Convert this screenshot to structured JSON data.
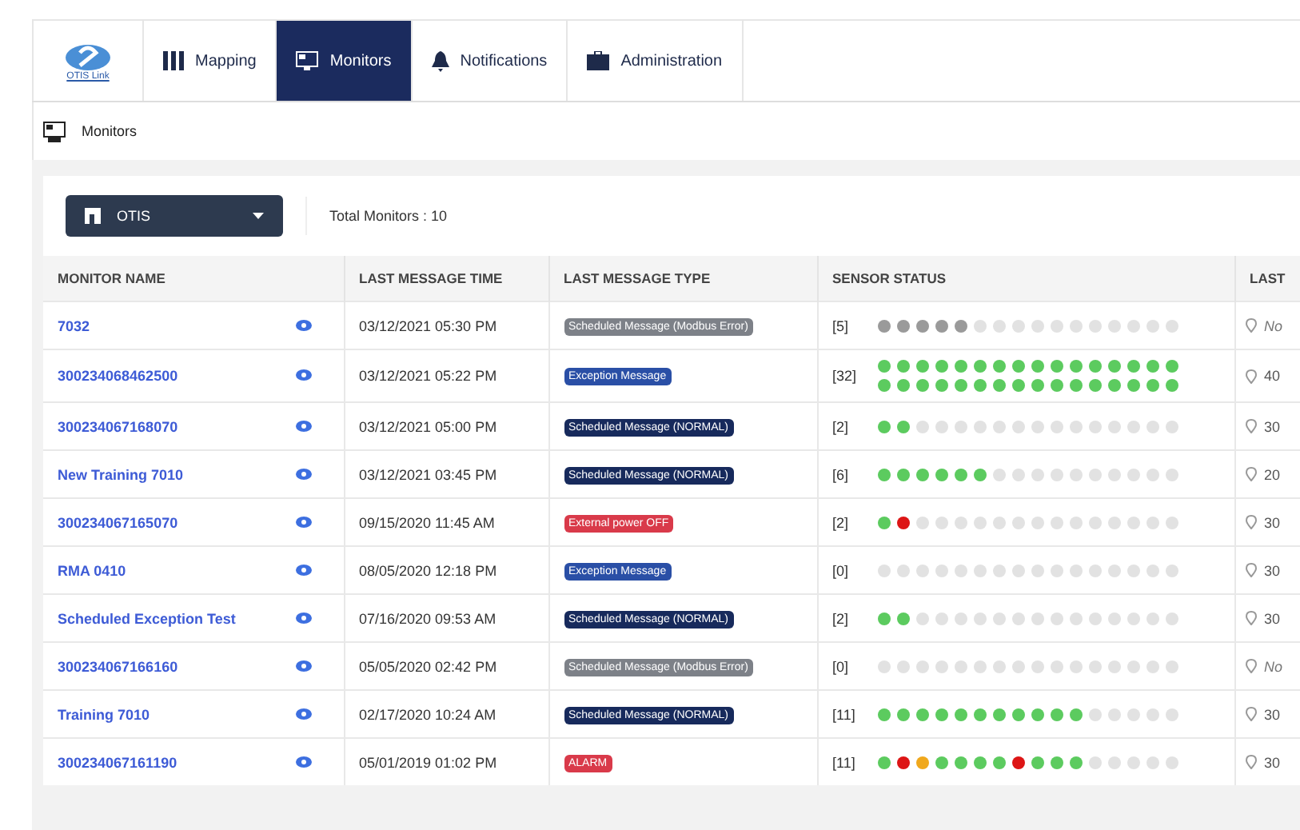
{
  "logo": {
    "text": "OTIS Link"
  },
  "nav": [
    {
      "label": "Mapping",
      "selected": false
    },
    {
      "label": "Monitors",
      "selected": true
    },
    {
      "label": "Notifications",
      "selected": false
    },
    {
      "label": "Administration",
      "selected": false
    }
  ],
  "breadcrumb": "Monitors",
  "org_select": {
    "value": "OTIS"
  },
  "total": "Total Monitors : 10",
  "table": {
    "columns": [
      "MONITOR NAME",
      "LAST MESSAGE TIME",
      "LAST MESSAGE TYPE",
      "SENSOR STATUS",
      "LAST"
    ],
    "rows": [
      {
        "name": "7032",
        "time": "03/12/2021 05:30 PM",
        "type": {
          "text": "Scheduled Message (Modbus Error)",
          "kind": "modbus"
        },
        "count": "[5]",
        "dots": [
          {
            "color": "#9a9a9a"
          },
          {
            "color": "#9a9a9a"
          },
          {
            "color": "#9a9a9a"
          },
          {
            "color": "#9a9a9a"
          },
          {
            "color": "#9a9a9a"
          },
          {
            "color": "#e2e2e2"
          },
          {
            "color": "#e2e2e2"
          },
          {
            "color": "#e2e2e2"
          },
          {
            "color": "#e2e2e2"
          },
          {
            "color": "#e2e2e2"
          },
          {
            "color": "#e2e2e2"
          },
          {
            "color": "#e2e2e2"
          },
          {
            "color": "#e2e2e2"
          },
          {
            "color": "#e2e2e2"
          },
          {
            "color": "#e2e2e2"
          },
          {
            "color": "#e2e2e2"
          }
        ],
        "last": "No",
        "last_italic": true
      },
      {
        "name": "300234068462500",
        "time": "03/12/2021 05:22 PM",
        "type": {
          "text": "Exception Message",
          "kind": "exception"
        },
        "count": "[32]",
        "dots": [
          {
            "color": "#5ccb5f"
          },
          {
            "color": "#5ccb5f"
          },
          {
            "color": "#5ccb5f"
          },
          {
            "color": "#5ccb5f"
          },
          {
            "color": "#5ccb5f"
          },
          {
            "color": "#5ccb5f"
          },
          {
            "color": "#5ccb5f"
          },
          {
            "color": "#5ccb5f"
          },
          {
            "color": "#5ccb5f"
          },
          {
            "color": "#5ccb5f"
          },
          {
            "color": "#5ccb5f"
          },
          {
            "color": "#5ccb5f"
          },
          {
            "color": "#5ccb5f"
          },
          {
            "color": "#5ccb5f"
          },
          {
            "color": "#5ccb5f"
          },
          {
            "color": "#5ccb5f"
          },
          {
            "color": "#5ccb5f"
          },
          {
            "color": "#5ccb5f"
          },
          {
            "color": "#5ccb5f"
          },
          {
            "color": "#5ccb5f"
          },
          {
            "color": "#5ccb5f"
          },
          {
            "color": "#5ccb5f"
          },
          {
            "color": "#5ccb5f"
          },
          {
            "color": "#5ccb5f"
          },
          {
            "color": "#5ccb5f"
          },
          {
            "color": "#5ccb5f"
          },
          {
            "color": "#5ccb5f"
          },
          {
            "color": "#5ccb5f"
          },
          {
            "color": "#5ccb5f"
          },
          {
            "color": "#5ccb5f"
          },
          {
            "color": "#5ccb5f"
          },
          {
            "color": "#5ccb5f"
          }
        ],
        "last": "40",
        "last_italic": false
      },
      {
        "name": "300234067168070",
        "time": "03/12/2021 05:00 PM",
        "type": {
          "text": "Scheduled Message (NORMAL)",
          "kind": "normal"
        },
        "count": "[2]",
        "dots": [
          {
            "color": "#5ccb5f"
          },
          {
            "color": "#5ccb5f"
          },
          {
            "color": "#e2e2e2"
          },
          {
            "color": "#e2e2e2"
          },
          {
            "color": "#e2e2e2"
          },
          {
            "color": "#e2e2e2"
          },
          {
            "color": "#e2e2e2"
          },
          {
            "color": "#e2e2e2"
          },
          {
            "color": "#e2e2e2"
          },
          {
            "color": "#e2e2e2"
          },
          {
            "color": "#e2e2e2"
          },
          {
            "color": "#e2e2e2"
          },
          {
            "color": "#e2e2e2"
          },
          {
            "color": "#e2e2e2"
          },
          {
            "color": "#e2e2e2"
          },
          {
            "color": "#e2e2e2"
          }
        ],
        "last": "30",
        "last_italic": false
      },
      {
        "name": "New Training 7010",
        "time": "03/12/2021 03:45 PM",
        "type": {
          "text": "Scheduled Message (NORMAL)",
          "kind": "normal"
        },
        "count": "[6]",
        "dots": [
          {
            "color": "#5ccb5f"
          },
          {
            "color": "#5ccb5f"
          },
          {
            "color": "#5ccb5f"
          },
          {
            "color": "#5ccb5f"
          },
          {
            "color": "#5ccb5f"
          },
          {
            "color": "#5ccb5f"
          },
          {
            "color": "#e2e2e2"
          },
          {
            "color": "#e2e2e2"
          },
          {
            "color": "#e2e2e2"
          },
          {
            "color": "#e2e2e2"
          },
          {
            "color": "#e2e2e2"
          },
          {
            "color": "#e2e2e2"
          },
          {
            "color": "#e2e2e2"
          },
          {
            "color": "#e2e2e2"
          },
          {
            "color": "#e2e2e2"
          },
          {
            "color": "#e2e2e2"
          }
        ],
        "last": "20",
        "last_italic": false
      },
      {
        "name": "300234067165070",
        "time": "09/15/2020 11:45 AM",
        "type": {
          "text": "External power OFF",
          "kind": "alert"
        },
        "count": "[2]",
        "dots": [
          {
            "color": "#5ccb5f"
          },
          {
            "color": "#dd1515"
          },
          {
            "color": "#e2e2e2"
          },
          {
            "color": "#e2e2e2"
          },
          {
            "color": "#e2e2e2"
          },
          {
            "color": "#e2e2e2"
          },
          {
            "color": "#e2e2e2"
          },
          {
            "color": "#e2e2e2"
          },
          {
            "color": "#e2e2e2"
          },
          {
            "color": "#e2e2e2"
          },
          {
            "color": "#e2e2e2"
          },
          {
            "color": "#e2e2e2"
          },
          {
            "color": "#e2e2e2"
          },
          {
            "color": "#e2e2e2"
          },
          {
            "color": "#e2e2e2"
          },
          {
            "color": "#e2e2e2"
          }
        ],
        "last": "30",
        "last_italic": false
      },
      {
        "name": "RMA 0410",
        "time": "08/05/2020 12:18 PM",
        "type": {
          "text": "Exception Message",
          "kind": "exception"
        },
        "count": "[0]",
        "dots": [
          {
            "color": "#e2e2e2"
          },
          {
            "color": "#e2e2e2"
          },
          {
            "color": "#e2e2e2"
          },
          {
            "color": "#e2e2e2"
          },
          {
            "color": "#e2e2e2"
          },
          {
            "color": "#e2e2e2"
          },
          {
            "color": "#e2e2e2"
          },
          {
            "color": "#e2e2e2"
          },
          {
            "color": "#e2e2e2"
          },
          {
            "color": "#e2e2e2"
          },
          {
            "color": "#e2e2e2"
          },
          {
            "color": "#e2e2e2"
          },
          {
            "color": "#e2e2e2"
          },
          {
            "color": "#e2e2e2"
          },
          {
            "color": "#e2e2e2"
          },
          {
            "color": "#e2e2e2"
          }
        ],
        "last": "30",
        "last_italic": false
      },
      {
        "name": "Scheduled Exception Test",
        "time": "07/16/2020 09:53 AM",
        "type": {
          "text": "Scheduled Message (NORMAL)",
          "kind": "normal"
        },
        "count": "[2]",
        "dots": [
          {
            "color": "#5ccb5f"
          },
          {
            "color": "#5ccb5f"
          },
          {
            "color": "#e2e2e2"
          },
          {
            "color": "#e2e2e2"
          },
          {
            "color": "#e2e2e2"
          },
          {
            "color": "#e2e2e2"
          },
          {
            "color": "#e2e2e2"
          },
          {
            "color": "#e2e2e2"
          },
          {
            "color": "#e2e2e2"
          },
          {
            "color": "#e2e2e2"
          },
          {
            "color": "#e2e2e2"
          },
          {
            "color": "#e2e2e2"
          },
          {
            "color": "#e2e2e2"
          },
          {
            "color": "#e2e2e2"
          },
          {
            "color": "#e2e2e2"
          },
          {
            "color": "#e2e2e2"
          }
        ],
        "last": "30",
        "last_italic": false
      },
      {
        "name": "300234067166160",
        "time": "05/05/2020 02:42 PM",
        "type": {
          "text": "Scheduled Message (Modbus Error)",
          "kind": "modbus"
        },
        "count": "[0]",
        "dots": [
          {
            "color": "#e2e2e2"
          },
          {
            "color": "#e2e2e2"
          },
          {
            "color": "#e2e2e2"
          },
          {
            "color": "#e2e2e2"
          },
          {
            "color": "#e2e2e2"
          },
          {
            "color": "#e2e2e2"
          },
          {
            "color": "#e2e2e2"
          },
          {
            "color": "#e2e2e2"
          },
          {
            "color": "#e2e2e2"
          },
          {
            "color": "#e2e2e2"
          },
          {
            "color": "#e2e2e2"
          },
          {
            "color": "#e2e2e2"
          },
          {
            "color": "#e2e2e2"
          },
          {
            "color": "#e2e2e2"
          },
          {
            "color": "#e2e2e2"
          },
          {
            "color": "#e2e2e2"
          }
        ],
        "last": "No",
        "last_italic": true
      },
      {
        "name": "Training 7010",
        "time": "02/17/2020 10:24 AM",
        "type": {
          "text": "Scheduled Message (NORMAL)",
          "kind": "normal"
        },
        "count": "[11]",
        "dots": [
          {
            "color": "#5ccb5f"
          },
          {
            "color": "#5ccb5f"
          },
          {
            "color": "#5ccb5f"
          },
          {
            "color": "#5ccb5f"
          },
          {
            "color": "#5ccb5f"
          },
          {
            "color": "#5ccb5f"
          },
          {
            "color": "#5ccb5f"
          },
          {
            "color": "#5ccb5f"
          },
          {
            "color": "#5ccb5f"
          },
          {
            "color": "#5ccb5f"
          },
          {
            "color": "#5ccb5f"
          },
          {
            "color": "#e2e2e2"
          },
          {
            "color": "#e2e2e2"
          },
          {
            "color": "#e2e2e2"
          },
          {
            "color": "#e2e2e2"
          },
          {
            "color": "#e2e2e2"
          }
        ],
        "last": "30",
        "last_italic": false
      },
      {
        "name": "300234067161190",
        "time": "05/01/2019 01:02 PM",
        "type": {
          "text": "ALARM",
          "kind": "alert"
        },
        "count": "[11]",
        "dots": [
          {
            "color": "#5ccb5f"
          },
          {
            "color": "#dd1515"
          },
          {
            "color": "#f0a81c"
          },
          {
            "color": "#5ccb5f"
          },
          {
            "color": "#5ccb5f"
          },
          {
            "color": "#5ccb5f"
          },
          {
            "color": "#5ccb5f"
          },
          {
            "color": "#dd1515"
          },
          {
            "color": "#5ccb5f"
          },
          {
            "color": "#5ccb5f"
          },
          {
            "color": "#5ccb5f"
          },
          {
            "color": "#e2e2e2"
          },
          {
            "color": "#e2e2e2"
          },
          {
            "color": "#e2e2e2"
          },
          {
            "color": "#e2e2e2"
          },
          {
            "color": "#e2e2e2"
          }
        ],
        "last": "30",
        "last_italic": false
      }
    ]
  }
}
